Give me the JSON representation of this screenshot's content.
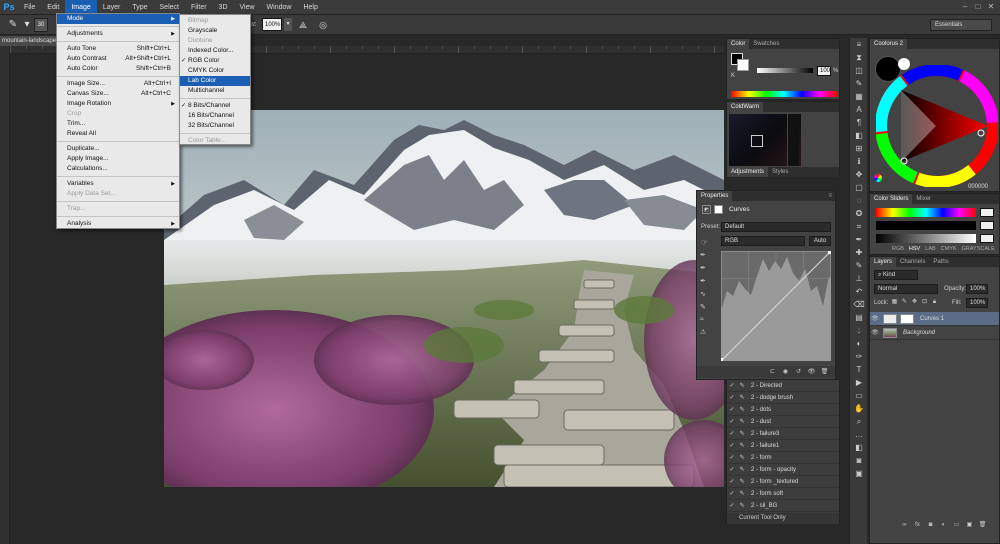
{
  "menubar": {
    "logo": "Ps",
    "items": [
      "File",
      "Edit",
      "Image",
      "Layer",
      "Type",
      "Select",
      "Filter",
      "3D",
      "View",
      "Window",
      "Help"
    ],
    "active_index": 2
  },
  "options_bar": {
    "tool_icon": "brush-icon",
    "brush_size": "30",
    "flow_label": "Flow:",
    "flow_value": "100%",
    "workspace": "Essentials"
  },
  "document": {
    "tab_title": "mountain-landscape"
  },
  "image_menu": {
    "items": [
      {
        "label": "Mode",
        "submenu": true,
        "highlighted": true
      },
      {
        "sep": true
      },
      {
        "label": "Adjustments",
        "submenu": true
      },
      {
        "sep": true
      },
      {
        "label": "Auto Tone",
        "shortcut": "Shift+Ctrl+L"
      },
      {
        "label": "Auto Contrast",
        "shortcut": "Alt+Shift+Ctrl+L"
      },
      {
        "label": "Auto Color",
        "shortcut": "Shift+Ctrl+B"
      },
      {
        "sep": true
      },
      {
        "label": "Image Size...",
        "shortcut": "Alt+Ctrl+I"
      },
      {
        "label": "Canvas Size...",
        "shortcut": "Alt+Ctrl+C"
      },
      {
        "label": "Image Rotation",
        "submenu": true
      },
      {
        "label": "Crop",
        "disabled": true
      },
      {
        "label": "Trim..."
      },
      {
        "label": "Reveal All"
      },
      {
        "sep": true
      },
      {
        "label": "Duplicate..."
      },
      {
        "label": "Apply Image..."
      },
      {
        "label": "Calculations..."
      },
      {
        "sep": true
      },
      {
        "label": "Variables",
        "submenu": true
      },
      {
        "label": "Apply Data Set...",
        "disabled": true
      },
      {
        "sep": true
      },
      {
        "label": "Trap...",
        "disabled": true
      },
      {
        "sep": true
      },
      {
        "label": "Analysis",
        "submenu": true
      }
    ]
  },
  "mode_menu": {
    "items": [
      {
        "label": "Bitmap",
        "disabled": true
      },
      {
        "label": "Grayscale"
      },
      {
        "label": "Duotone",
        "disabled": true
      },
      {
        "label": "Indexed Color..."
      },
      {
        "label": "RGB Color",
        "checked": true
      },
      {
        "label": "CMYK Color"
      },
      {
        "label": "Lab Color",
        "highlighted": true
      },
      {
        "label": "Multichannel"
      },
      {
        "sep": true
      },
      {
        "label": "8 Bits/Channel",
        "checked": true
      },
      {
        "label": "16 Bits/Channel"
      },
      {
        "label": "32 Bits/Channel"
      },
      {
        "sep": true
      },
      {
        "label": "Color Table...",
        "disabled": true
      }
    ]
  },
  "color_panel": {
    "tabs": [
      "Color",
      "Swatches"
    ],
    "k_label": "K",
    "k_value": "100",
    "pct": "%"
  },
  "colorwarm_panel": {
    "tabs": [
      "ColdWarm"
    ],
    "bottom_tabs": [
      "Adjustments",
      "Styles"
    ]
  },
  "coolorus": {
    "title": "Coolorus 2",
    "value": "000000"
  },
  "color_sliders": {
    "tabs": [
      "Color Sliders",
      "Mixer"
    ],
    "modes": [
      "RGB",
      "HSV",
      "LAB",
      "CMYK",
      "GRAYSCALE"
    ]
  },
  "layers_panel": {
    "tabs": [
      "Layers",
      "Channels",
      "Paths"
    ],
    "kind": "Kind",
    "blend": "Normal",
    "opacity_label": "Opacity:",
    "opacity": "100%",
    "lock_label": "Lock:",
    "fill_label": "Fill:",
    "fill": "100%",
    "layers": [
      {
        "name": "Curves 1",
        "selected": true
      },
      {
        "name": "Background",
        "selected": false
      }
    ]
  },
  "properties_panel": {
    "tab": "Properties",
    "title": "Curves",
    "preset_label": "Preset:",
    "preset": "Default",
    "channel": "RGB",
    "auto": "Auto"
  },
  "actions_panel": {
    "items": [
      "2 - Directed",
      "2 - dodge brush",
      "2 - dots",
      "2 - dust",
      "2 - failure3",
      "2 - failure1",
      "2 - form",
      "2 - form - opacity",
      "2 - form _textured",
      "2 - form soft",
      "2 - sil_BG"
    ],
    "footer": "Current Tool Only"
  }
}
